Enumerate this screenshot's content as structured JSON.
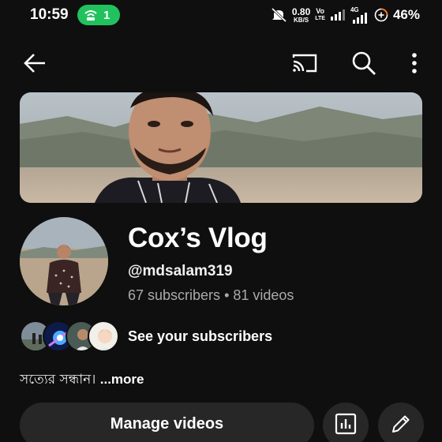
{
  "status_bar": {
    "time": "10:59",
    "hotspot_count": "1",
    "speed_value": "0.80",
    "speed_unit": "KB/S",
    "volte_top": "Vo",
    "volte_bottom": "LTE",
    "network_type": "4G",
    "battery": "46%"
  },
  "app_bar": {
    "icons": [
      "back-arrow-icon",
      "cast-icon",
      "search-icon",
      "more-vert-icon"
    ]
  },
  "channel": {
    "name": "Cox’s Vlog",
    "handle": "@mdsalam319",
    "subscribers": "67 subscribers",
    "separator": "•",
    "videos": "81 videos",
    "see_subscribers": "See your subscribers",
    "description": "সত্যের সন্ধান। ",
    "more": "...more"
  },
  "actions": {
    "manage_videos": "Manage videos",
    "analytics_icon": "analytics-icon",
    "edit_icon": "edit-pencil-icon"
  },
  "colors": {
    "background": "#0f0f0f",
    "button_bg": "#272727",
    "hotspot_green": "#21c25e",
    "secondary_text": "#aaaaaa"
  }
}
